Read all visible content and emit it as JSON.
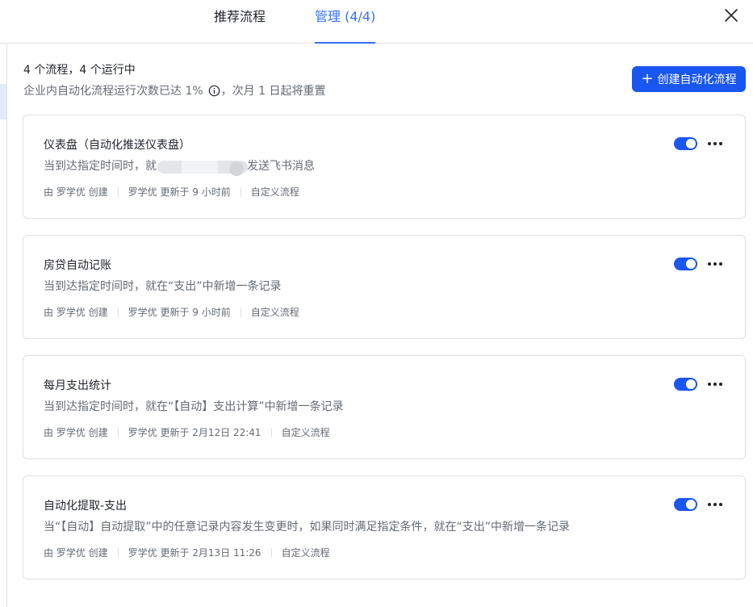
{
  "header": {
    "tabs": [
      {
        "label": "推荐流程"
      },
      {
        "label": "管理 (4/4)"
      }
    ]
  },
  "summary": {
    "count_text": "4 个流程，4 个运行中",
    "quota_text": "企业内自动化流程运行次数已达 1%",
    "reset_text": "，次月 1 日起将重置"
  },
  "create_button": {
    "label": "创建自动化流程"
  },
  "flows": [
    {
      "title": "仪表盘（自动化推送仪表盘）",
      "desc_visible_start": "当到达指定时间时，就",
      "desc_visible_end": "发送飞书消息",
      "creator": "由 罗学优 创建",
      "updated": "罗学优 更新于 9 小时前",
      "type": "自定义流程",
      "enabled": true
    },
    {
      "title": "房贷自动记账",
      "desc": "当到达指定时间时，就在“支出”中新增一条记录",
      "creator": "由 罗学优 创建",
      "updated": "罗学优 更新于 9 小时前",
      "type": "自定义流程",
      "enabled": true
    },
    {
      "title": "每月支出统计",
      "desc": "当到达指定时间时，就在“【自动】支出计算”中新增一条记录",
      "creator": "由 罗学优 创建",
      "updated": "罗学优 更新于 2月12日 22:41",
      "type": "自定义流程",
      "enabled": true
    },
    {
      "title": "自动化提取-支出",
      "desc": "当“【自动】自动提取”中的任意记录内容发生变更时，如果同时满足指定条件，就在“支出”中新增一条记录",
      "creator": "由 罗学优 创建",
      "updated": "罗学优 更新于 2月13日 11:26",
      "type": "自定义流程",
      "enabled": true
    }
  ],
  "colors": {
    "accent": "#3370ff",
    "button": "#1a56f0",
    "border": "#dee0e3",
    "text_primary": "#1f2329",
    "text_secondary": "#646a73"
  },
  "icons": {
    "close": "close-icon",
    "info": "info-icon",
    "plus": "plus-icon",
    "more": "more-horizontal-icon"
  }
}
